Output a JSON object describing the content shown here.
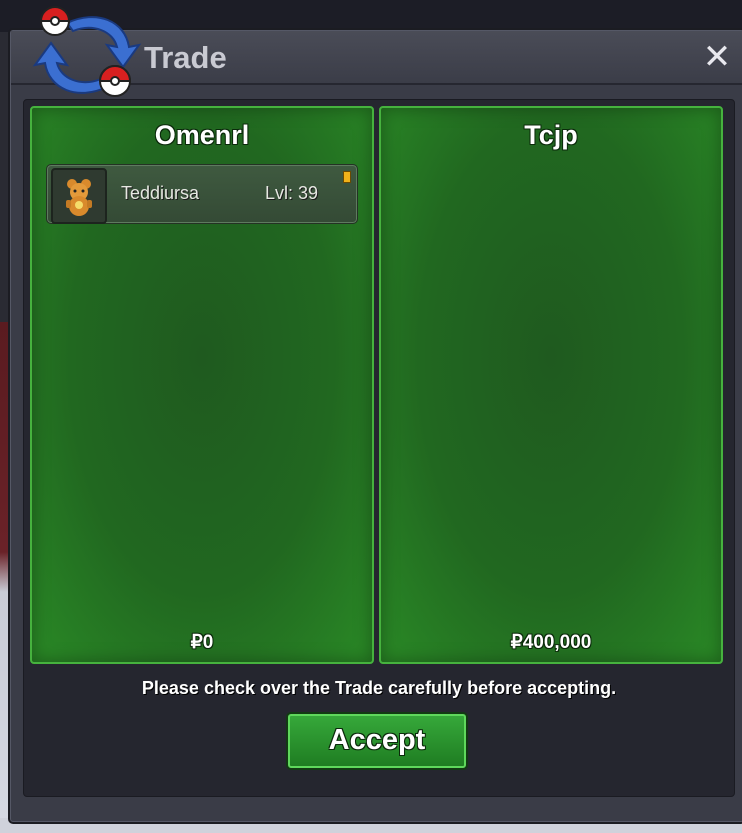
{
  "window": {
    "title": "Trade",
    "close_glyph": "✕"
  },
  "left_panel": {
    "player_name": "Omenrl",
    "pokemon": [
      {
        "name": "Teddiursa",
        "level": "Lvl: 39",
        "icon": "teddiursa-sprite-icon",
        "held_item": true
      }
    ],
    "money": "₽0"
  },
  "right_panel": {
    "player_name": "Tcjp",
    "pokemon": [],
    "money": "₽400,000"
  },
  "notice": "Please check over the Trade carefully before accepting.",
  "accept_button": "Accept",
  "colors": {
    "panel_green": "#216820",
    "panel_border": "#46b23e",
    "accept_green": "#2a9a2d",
    "window_bg": "#3a3c47"
  }
}
